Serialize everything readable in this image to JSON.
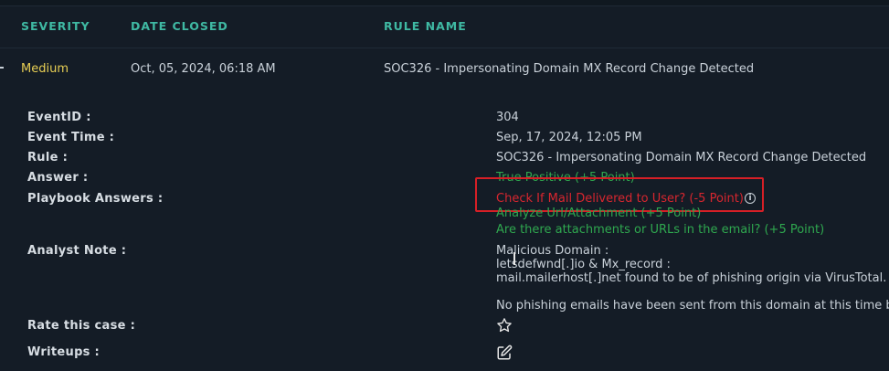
{
  "table": {
    "headers": {
      "severity": "SEVERITY",
      "date_closed": "DATE CLOSED",
      "rule_name": "RULE NAME"
    },
    "row": {
      "severity": "Medium",
      "date_closed": "Oct, 05, 2024, 06:18 AM",
      "rule_name": "SOC326 - Impersonating Domain MX Record Change Detected"
    }
  },
  "details": {
    "labels": {
      "event_id": "EventID :",
      "event_time": "Event Time :",
      "rule": "Rule :",
      "answer": "Answer :",
      "playbook_answers": "Playbook Answers :",
      "analyst_note": "Analyst Note :",
      "rate_case": "Rate this case :",
      "writeups": "Writeups :"
    },
    "values": {
      "event_id": "304",
      "event_time": "Sep, 17, 2024, 12:05 PM",
      "rule": "SOC326 - Impersonating Domain MX Record Change Detected",
      "answer": "True Positive (+5 Point)",
      "playbook": [
        "Check If Mail Delivered to User? (-5 Point)",
        "Analyze Url/Attachment (+5 Point)",
        "Are there attachments or URLs in the email? (+5 Point)"
      ],
      "analyst_note": [
        "Malicious Domain :",
        "letsdefwnd[.]io & Mx_record :",
        "mail.mailerhost[.]net found to be of phishing origin via VirusTotal.",
        "No phishing emails have been sent from this domain at this time bu"
      ]
    }
  },
  "icons": {
    "info": "info-icon",
    "rate": "star-icon",
    "writeup": "edit-icon"
  },
  "colors": {
    "accent": "#3fb9a3",
    "severity_medium": "#e8cf54",
    "positive": "#2fa84f",
    "negative": "#d7262f"
  }
}
